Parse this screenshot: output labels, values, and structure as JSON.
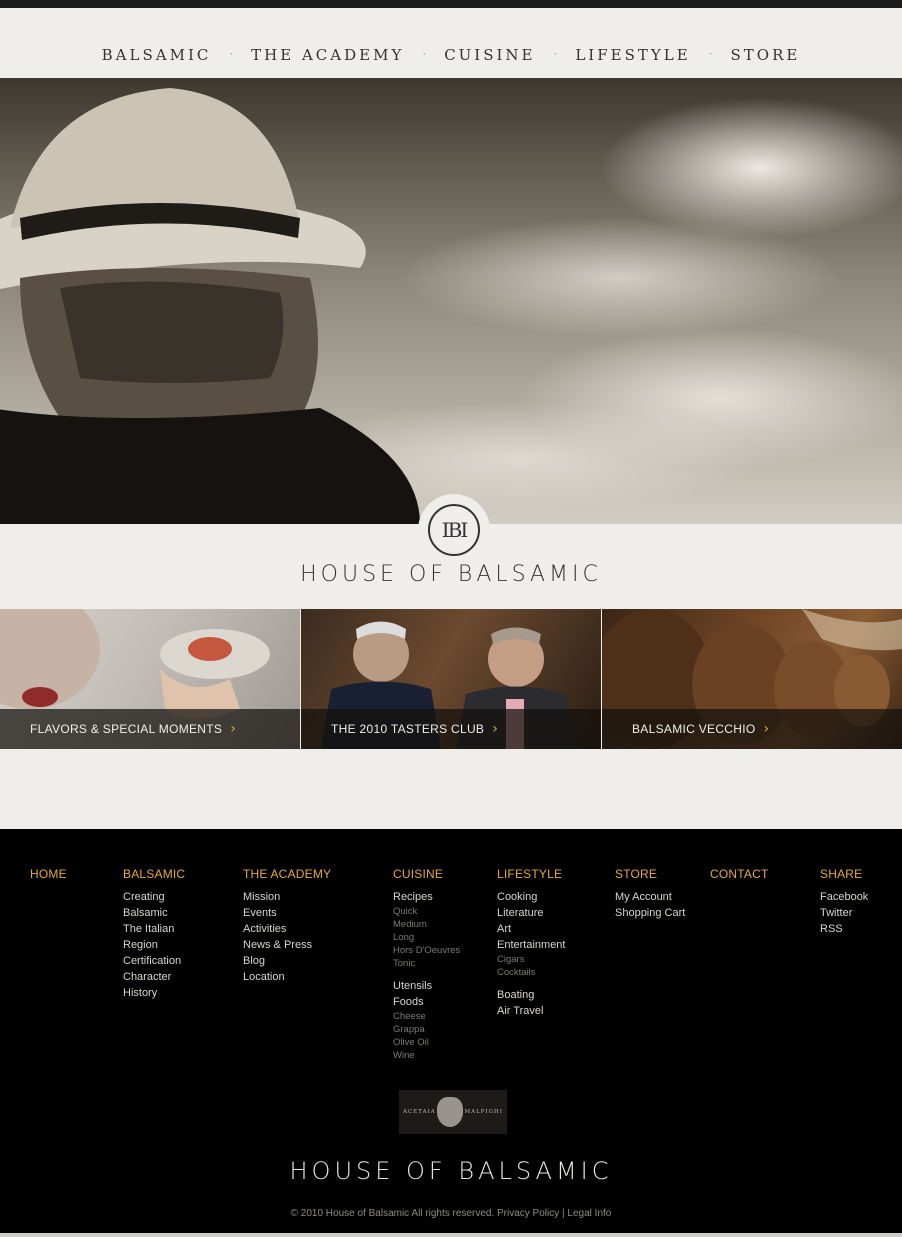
{
  "nav": {
    "items": [
      {
        "label": "BALSAMIC"
      },
      {
        "label": "THE ACADEMY"
      },
      {
        "label": "CUISINE"
      },
      {
        "label": "LIFESTYLE"
      },
      {
        "label": "STORE"
      }
    ],
    "separator": "·"
  },
  "brand": {
    "monogram": "IBI",
    "title": "HOUSE OF BALSAMIC"
  },
  "tiles": [
    {
      "label": "FLAVORS & SPECIAL MOMENTS",
      "arrow": "›"
    },
    {
      "label": "THE 2010 TASTERS CLUB",
      "arrow": "›"
    },
    {
      "label": "BALSAMIC VECCHIO",
      "arrow": "›"
    }
  ],
  "footer": {
    "home": "HOME",
    "balsamic": {
      "heading": "BALSAMIC",
      "links": [
        "Creating",
        "Balsamic",
        "The Italian",
        "Region",
        "Certification",
        "Character",
        "History"
      ]
    },
    "academy": {
      "heading": "THE ACADEMY",
      "links": [
        "Mission",
        "Events",
        "Activities",
        "News & Press",
        "Blog",
        "Location"
      ]
    },
    "cuisine": {
      "heading": "CUISINE",
      "recipes": "Recipes",
      "recipes_sub": [
        "Quick",
        "Medium",
        "Long",
        "Hors D'Oeuvres",
        "Tonic"
      ],
      "utensils": "Utensils",
      "foods": "Foods",
      "foods_sub": [
        "Cheese",
        "Grappa",
        "Olive Oil",
        "Wine"
      ]
    },
    "lifestyle": {
      "heading": "LIFESTYLE",
      "links": [
        "Cooking",
        "Literature",
        "Art",
        "Entertainment"
      ],
      "entertainment_sub": [
        "Cigars",
        "Cocktails"
      ],
      "links2": [
        "Boating",
        "Air Travel"
      ]
    },
    "store": {
      "heading": "STORE",
      "links": [
        "My Account",
        "Shopping Cart"
      ]
    },
    "contact": "CONTACT",
    "share": {
      "heading": "SHARE",
      "links": [
        "Facebook",
        "Twitter",
        "RSS"
      ]
    },
    "partner": {
      "left": "ACETAIA",
      "right": "MALPIGHI"
    },
    "brand": "HOUSE OF BALSAMIC",
    "copyright": "© 2010 House of Balsamic All rights reserved.",
    "privacy": "Privacy Policy",
    "divider": "|",
    "legal": "Legal Info"
  },
  "colors": {
    "accent": "#e7a93c",
    "background": "#efeeea",
    "footer_bg": "#000000"
  }
}
